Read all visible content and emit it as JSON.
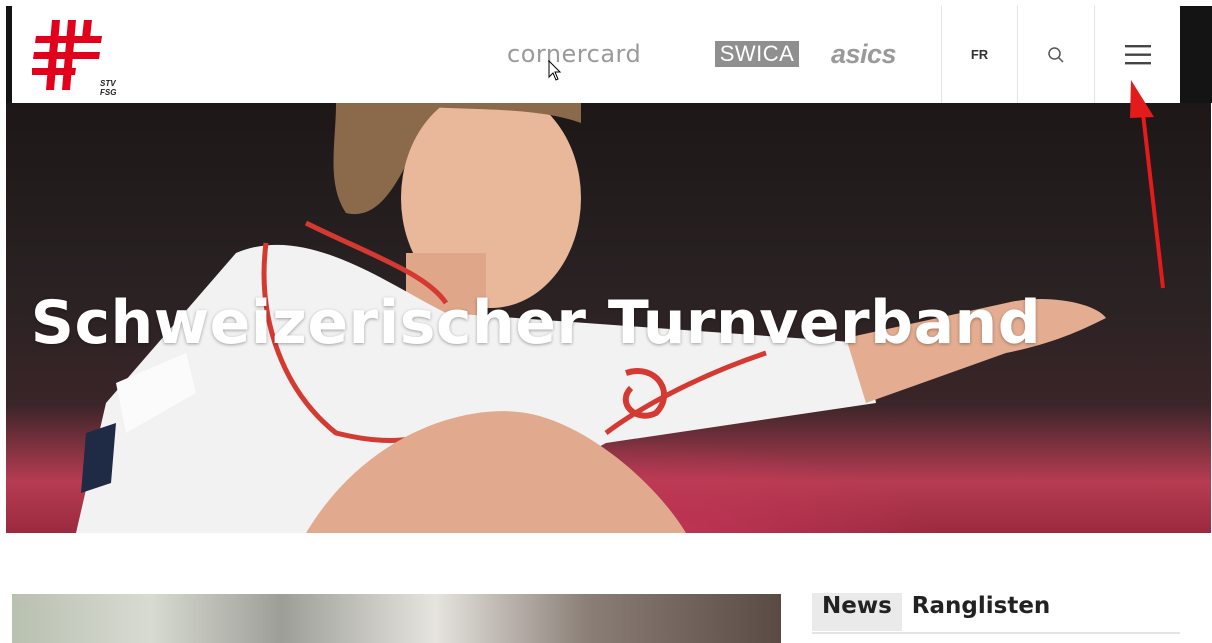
{
  "header": {
    "logo_text_line1": "STV",
    "logo_text_line2": "FSG",
    "sponsors": [
      "cornercard",
      "SWICA",
      "asics"
    ],
    "language": "FR"
  },
  "hero": {
    "title": "Schweizerischer Turnverband"
  },
  "tabs": [
    {
      "label": "News",
      "active": true
    },
    {
      "label": "Ranglisten",
      "active": false
    }
  ],
  "colors": {
    "brand_red": "#e3001b",
    "annotation_arrow": "#e31b1b"
  },
  "icons": [
    "logo-cross-icon",
    "search-icon",
    "hamburger-menu-icon",
    "mouse-cursor-icon",
    "red-arrow-icon"
  ]
}
